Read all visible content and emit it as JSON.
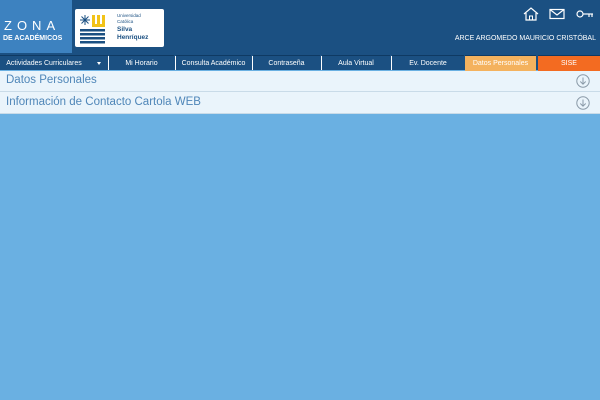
{
  "brand": {
    "zona_title": "ZONA",
    "zona_subtitle": "DE ACADÉMICOS",
    "logo_line1": "Universidad",
    "logo_line2": "Católica",
    "logo_name1": "Silva",
    "logo_name2": "Henríquez",
    "logo_icon": "university-logo"
  },
  "header_icons": [
    {
      "name": "home-icon"
    },
    {
      "name": "mail-icon"
    },
    {
      "name": "key-icon"
    }
  ],
  "user": {
    "name": "ARCE ARGOMEDO MAURICIO CRISTÓBAL"
  },
  "nav": {
    "items": [
      {
        "label": "Actividades Curriculares",
        "dropdown": true
      },
      {
        "label": "Mi Horario"
      },
      {
        "label": "Consulta Académico"
      },
      {
        "label": "Contraseña"
      },
      {
        "label": "Aula Virtual"
      },
      {
        "label": "Ev. Docente"
      },
      {
        "label": "Datos Personales",
        "active": true
      },
      {
        "label": "SISE"
      }
    ]
  },
  "sections": [
    {
      "label": "Datos Personales",
      "icon": "expand-down-icon"
    },
    {
      "label": "Información de Contacto Cartola WEB",
      "icon": "expand-down-icon"
    }
  ],
  "colors": {
    "header_bg": "#1b5082",
    "zona_bg": "#3d82c0",
    "active_tab": "#f4b25e",
    "sise_tab": "#f36b21",
    "page_bg": "#6ab0e2",
    "accordion_text": "#4f86b8"
  }
}
